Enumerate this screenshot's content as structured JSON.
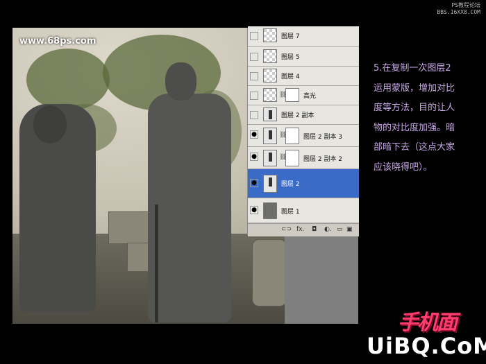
{
  "watermark": {
    "line1": "PS教程论坛",
    "line2": "BBS.16XX8.COM"
  },
  "photo": {
    "site_watermark": "www.68ps.com"
  },
  "layers_panel": {
    "top_fragment": "图层 7",
    "layers": [
      {
        "name": "图层 7",
        "visible": false,
        "thumb": "transparent",
        "mask": false,
        "selected": false
      },
      {
        "name": "图层 5",
        "visible": false,
        "thumb": "transparent",
        "mask": false,
        "selected": false
      },
      {
        "name": "图层 4",
        "visible": false,
        "thumb": "transparent",
        "mask": false,
        "selected": false
      },
      {
        "name": "高光",
        "visible": false,
        "thumb": "transparent",
        "mask": true,
        "selected": false
      },
      {
        "name": "图层 2 副本",
        "visible": false,
        "thumb": "figure",
        "mask": false,
        "selected": false
      },
      {
        "name": "图层 2 副本 3",
        "visible": true,
        "thumb": "figure",
        "mask": true,
        "selected": false
      },
      {
        "name": "图层 2 副本 2",
        "visible": true,
        "thumb": "figure",
        "mask": true,
        "selected": false
      },
      {
        "name": "图层 2",
        "visible": true,
        "thumb": "figure",
        "mask": false,
        "selected": true
      },
      {
        "name": "图层 1",
        "visible": true,
        "thumb": "photo",
        "mask": false,
        "selected": false
      }
    ],
    "footer_icons": [
      "link-icon",
      "fx-icon",
      "mask-icon",
      "adjustment-icon",
      "folder-icon",
      "new-layer-icon",
      "trash-icon"
    ],
    "footer_glyphs": [
      "⊂⊃",
      "fx.",
      "◘",
      "◐.",
      "▭",
      "▣",
      "🗑"
    ]
  },
  "description": {
    "lines": [
      "5.在复制一次图层2",
      "运用蒙版，增加对比",
      "度等方法，目的让人",
      "物的对比度加强。暗",
      "部暗下去（这点大家",
      "应该晓得吧）。"
    ]
  },
  "logo": {
    "cn": "手机面",
    "en": "UiBQ.CoM"
  },
  "colors": {
    "selected_layer": "#3a6bc6",
    "description_text": "#c9a8e8",
    "logo_pink": "#ff3d6e"
  }
}
